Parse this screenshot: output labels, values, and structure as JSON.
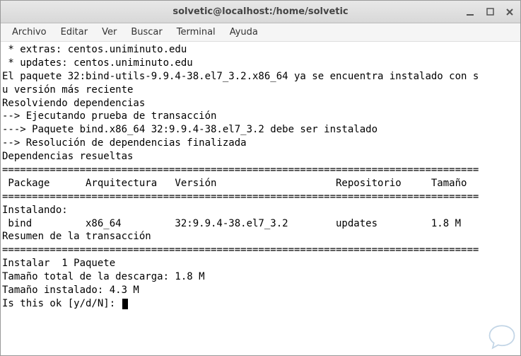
{
  "titlebar": {
    "title": "solvetic@localhost:/home/solvetic"
  },
  "menubar": {
    "items": [
      "Archivo",
      "Editar",
      "Ver",
      "Buscar",
      "Terminal",
      "Ayuda"
    ]
  },
  "terminal": {
    "lines": [
      " * extras: centos.uniminuto.edu",
      " * updates: centos.uniminuto.edu",
      "El paquete 32:bind-utils-9.9.4-38.el7_3.2.x86_64 ya se encuentra instalado con s",
      "u versión más reciente",
      "Resolviendo dependencias",
      "--> Ejecutando prueba de transacción",
      "---> Paquete bind.x86_64 32:9.9.4-38.el7_3.2 debe ser instalado",
      "--> Resolución de dependencias finalizada",
      "",
      "Dependencias resueltas",
      "",
      "================================================================================",
      " Package      Arquitectura   Versión                    Repositorio     Tamaño",
      "================================================================================",
      "Instalando:",
      " bind         x86_64         32:9.9.4-38.el7_3.2        updates         1.8 M",
      "",
      "Resumen de la transacción",
      "================================================================================",
      "Instalar  1 Paquete",
      "",
      "Tamaño total de la descarga: 1.8 M",
      "Tamaño instalado: 4.3 M"
    ],
    "prompt": "Is this ok [y/d/N]: "
  }
}
